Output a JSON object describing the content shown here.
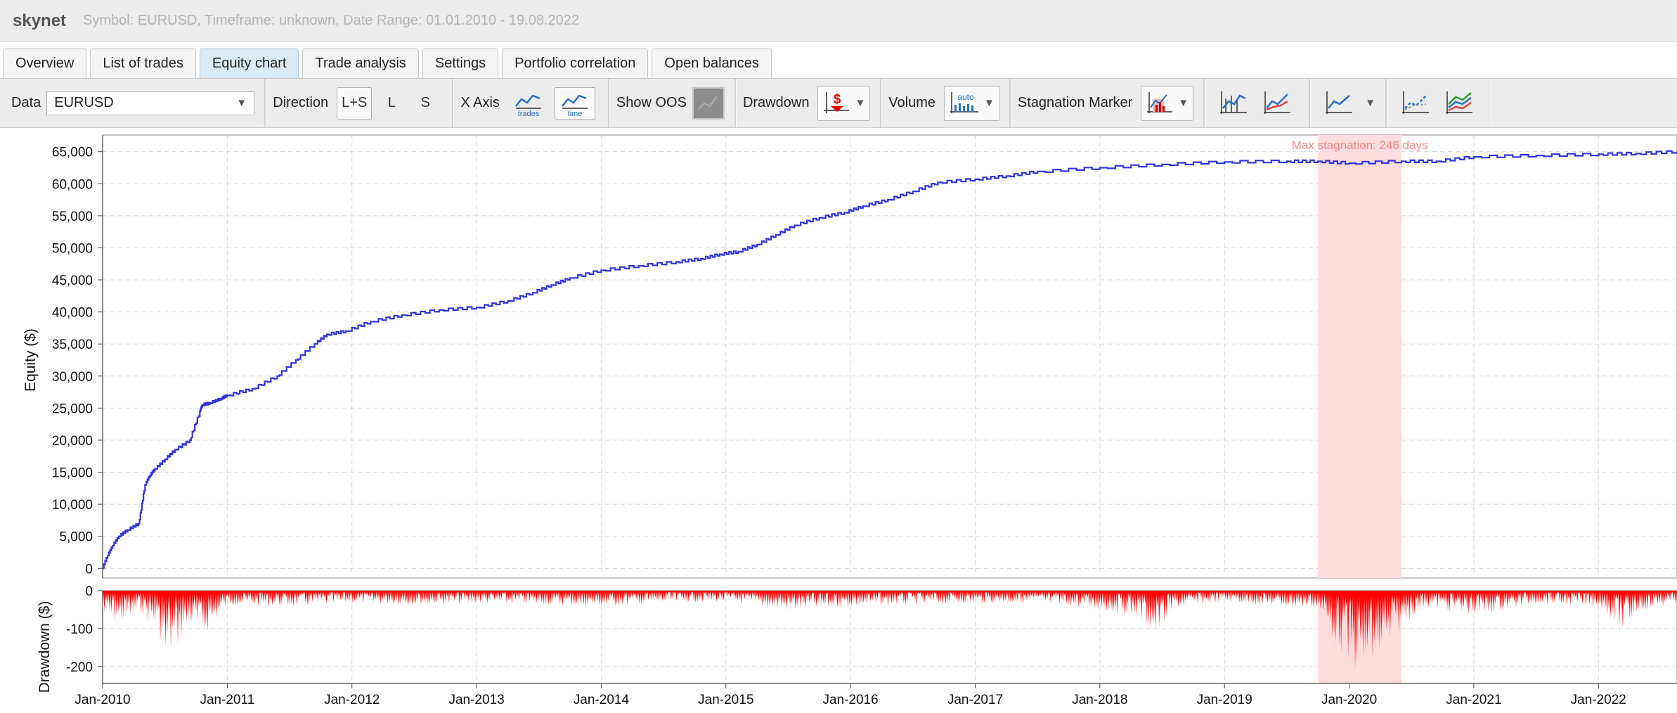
{
  "title": {
    "app_name": "skynet",
    "info": "Symbol: EURUSD, Timeframe: unknown, Date Range: 01.01.2010 - 19.08.2022"
  },
  "tabs": [
    {
      "label": "Overview",
      "active": false
    },
    {
      "label": "List of trades",
      "active": false
    },
    {
      "label": "Equity chart",
      "active": true
    },
    {
      "label": "Trade analysis",
      "active": false
    },
    {
      "label": "Settings",
      "active": false
    },
    {
      "label": "Portfolio correlation",
      "active": false
    },
    {
      "label": "Open balances",
      "active": false
    }
  ],
  "toolbar": {
    "data_label": "Data",
    "data_value": "EURUSD",
    "direction_label": "Direction",
    "direction_options": [
      "L+S",
      "L",
      "S"
    ],
    "direction_selected": "L+S",
    "xaxis_label": "X Axis",
    "xaxis_trades": "trades",
    "xaxis_time": "time",
    "xaxis_selected": "time",
    "show_oos_label": "Show OOS",
    "drawdown_label": "Drawdown",
    "drawdown_icon": "$",
    "volume_label": "Volume",
    "volume_icon": "auto",
    "stagnation_label": "Stagnation Marker"
  },
  "colors": {
    "equity_line": "#3333e0",
    "drawdown_fill": "#ff0000",
    "stagnation_band": "#fcdcdc",
    "stagnation_text": "#f08a8a",
    "grid": "#d8d8d8"
  },
  "chart_data": {
    "type": "line",
    "ylabel": "Equity ($)",
    "y2label": "Drawdown ($)",
    "ylim": [
      -1500,
      66500
    ],
    "yticks": [
      "65,000",
      "60,000",
      "55,000",
      "50,000",
      "45,000",
      "40,000",
      "35,000",
      "30,000",
      "25,000",
      "20,000",
      "15,000",
      "10,000",
      "5,000",
      "0"
    ],
    "dd_ylim": [
      -245,
      0
    ],
    "dd_yticks": [
      "0",
      "-100",
      "-200"
    ],
    "xlim": [
      2010.0,
      2022.63
    ],
    "xticks": [
      "Jan-2010",
      "Jan-2011",
      "Jan-2012",
      "Jan-2013",
      "Jan-2014",
      "Jan-2015",
      "Jan-2016",
      "Jan-2017",
      "Jan-2018",
      "Jan-2019",
      "Jan-2020",
      "Jan-2021",
      "Jan-2022"
    ],
    "stagnation": {
      "label": "Max stagnation: 246 days",
      "start": 2019.75,
      "end": 2020.42
    },
    "equity": {
      "x": [
        2010.0,
        2010.04,
        2010.08,
        2010.13,
        2010.2,
        2010.29,
        2010.34,
        2010.38,
        2010.42,
        2010.5,
        2010.58,
        2010.7,
        2010.78,
        2010.8,
        2010.86,
        2010.95,
        2011.0,
        2011.2,
        2011.4,
        2011.55,
        2011.7,
        2011.8,
        2011.95,
        2012.15,
        2012.4,
        2012.7,
        2013.0,
        2013.25,
        2013.45,
        2013.6,
        2013.75,
        2014.0,
        2014.3,
        2014.6,
        2014.8,
        2014.95,
        2015.1,
        2015.25,
        2015.4,
        2015.55,
        2015.75,
        2015.95,
        2016.1,
        2016.3,
        2016.5,
        2016.7,
        2017.0,
        2017.25,
        2017.5,
        2018.0,
        2018.5,
        2019.0,
        2019.5,
        2019.75,
        2020.0,
        2020.42,
        2020.7,
        2021.0,
        2021.5,
        2022.0,
        2022.3,
        2022.63
      ],
      "y": [
        0,
        2000,
        3500,
        5000,
        6000,
        7000,
        13000,
        14500,
        15500,
        17000,
        18500,
        20000,
        24500,
        25500,
        25800,
        26500,
        27000,
        28000,
        30000,
        32500,
        35000,
        36500,
        37000,
        38500,
        39500,
        40300,
        40700,
        41700,
        43000,
        44200,
        45300,
        46500,
        47200,
        47800,
        48300,
        49000,
        49400,
        50500,
        52000,
        53500,
        54700,
        55500,
        56500,
        57500,
        58800,
        60200,
        60700,
        61200,
        61900,
        62500,
        63000,
        63400,
        63500,
        63500,
        63200,
        63500,
        63500,
        64200,
        64400,
        64600,
        64700,
        65000
      ]
    },
    "drawdown": {
      "x": [
        2010.0,
        2010.15,
        2010.3,
        2010.45,
        2010.5,
        2010.7,
        2010.8,
        2011.0,
        2011.5,
        2012.0,
        2012.5,
        2013.0,
        2013.5,
        2014.0,
        2014.5,
        2015.0,
        2015.5,
        2016.0,
        2016.5,
        2017.0,
        2017.5,
        2018.0,
        2018.3,
        2018.45,
        2018.6,
        2019.0,
        2019.4,
        2019.75,
        2019.85,
        2020.0,
        2020.1,
        2020.2,
        2020.3,
        2020.42,
        2020.6,
        2020.8,
        2021.0,
        2021.5,
        2022.0,
        2022.1,
        2022.2,
        2022.3,
        2022.63
      ],
      "y": [
        -70,
        -90,
        -60,
        -110,
        -200,
        -95,
        -130,
        -40,
        -45,
        -35,
        -40,
        -35,
        -40,
        -45,
        -35,
        -30,
        -55,
        -45,
        -40,
        -35,
        -35,
        -55,
        -70,
        -125,
        -50,
        -30,
        -45,
        -50,
        -120,
        -200,
        -232,
        -195,
        -170,
        -100,
        -45,
        -55,
        -70,
        -35,
        -45,
        -75,
        -115,
        -60,
        -35
      ]
    }
  }
}
